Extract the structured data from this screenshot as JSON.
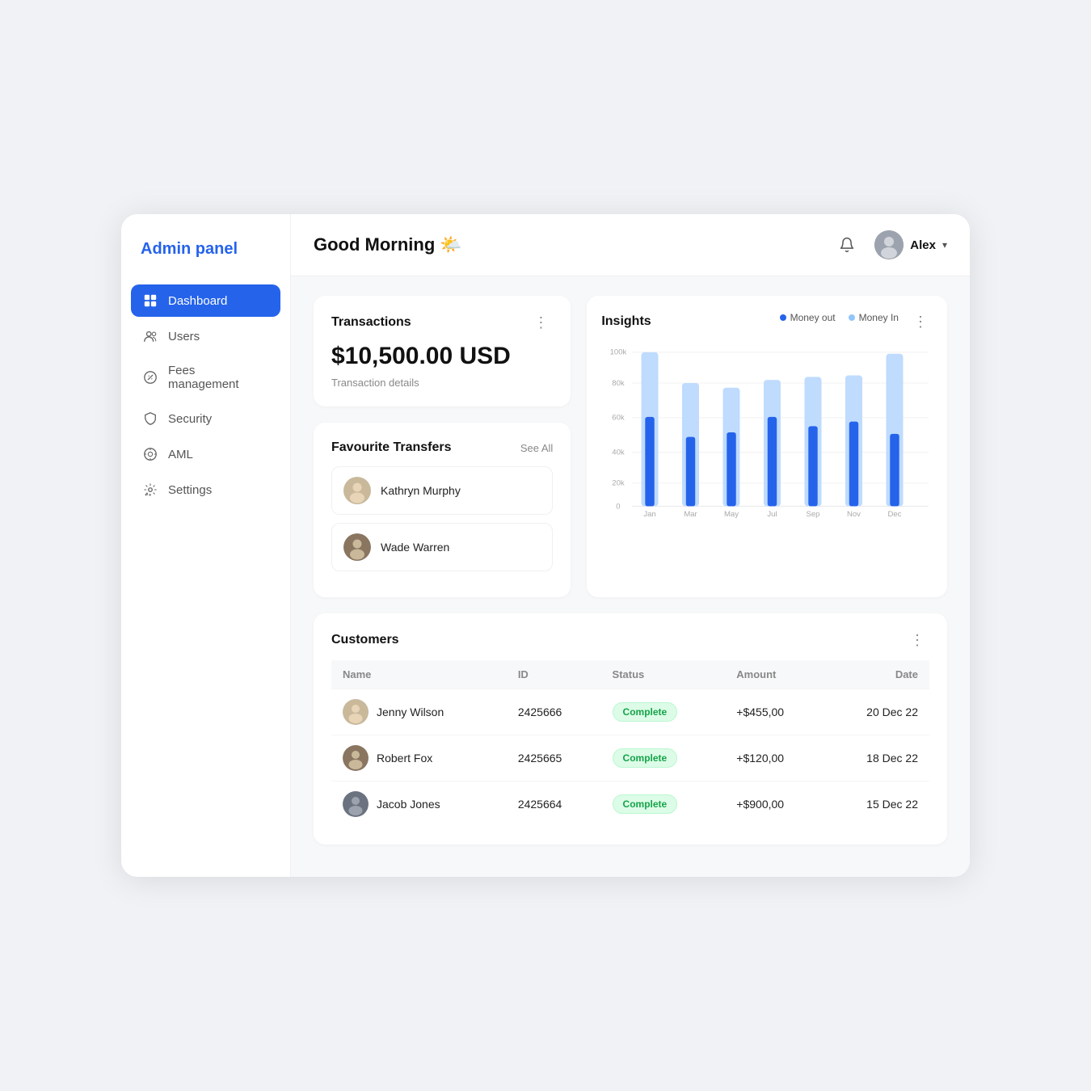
{
  "app": {
    "logo_blue": "Admin",
    "logo_dark": " panel"
  },
  "sidebar": {
    "items": [
      {
        "id": "dashboard",
        "label": "Dashboard",
        "active": true
      },
      {
        "id": "users",
        "label": "Users",
        "active": false
      },
      {
        "id": "fees",
        "label": "Fees management",
        "active": false
      },
      {
        "id": "security",
        "label": "Security",
        "active": false
      },
      {
        "id": "aml",
        "label": "AML",
        "active": false
      },
      {
        "id": "settings",
        "label": "Settings",
        "active": false
      }
    ]
  },
  "header": {
    "greeting": "Good Morning",
    "greeting_emoji": "🌤️",
    "user_name": "Alex",
    "bell_title": "Notifications"
  },
  "transactions": {
    "title": "Transactions",
    "amount": "$10,500.00 USD",
    "details_link": "Transaction details"
  },
  "favourite_transfers": {
    "title": "Favourite Transfers",
    "see_all": "See All",
    "contacts": [
      {
        "name": "Kathryn Murphy"
      },
      {
        "name": "Wade Warren"
      }
    ]
  },
  "insights": {
    "title": "Insights",
    "legend": [
      {
        "label": "Money out",
        "color": "#2563eb"
      },
      {
        "label": "Money In",
        "color": "#93c5fd"
      }
    ],
    "months": [
      "Jan",
      "Mar",
      "May",
      "Jul",
      "Sep",
      "Nov",
      "Dec"
    ],
    "y_labels": [
      "0",
      "20k",
      "40k",
      "60k",
      "80k",
      "100k"
    ],
    "bars": [
      {
        "month": "Jan",
        "out": 58,
        "in": 100
      },
      {
        "month": "Mar",
        "out": 45,
        "in": 82
      },
      {
        "month": "May",
        "out": 48,
        "in": 78
      },
      {
        "month": "Jul",
        "out": 58,
        "in": 84
      },
      {
        "month": "Sep",
        "out": 52,
        "in": 85
      },
      {
        "month": "Nov",
        "out": 55,
        "in": 86
      },
      {
        "month": "Dec",
        "out": 48,
        "in": 99
      }
    ]
  },
  "customers": {
    "title": "Customers",
    "columns": [
      "Name",
      "ID",
      "Status",
      "Amount",
      "Date"
    ],
    "rows": [
      {
        "name": "Jenny Wilson",
        "id": "2425666",
        "status": "Complete",
        "amount": "+$455,00",
        "date": "20 Dec 22"
      },
      {
        "name": "Robert Fox",
        "id": "2425665",
        "status": "Complete",
        "amount": "+$120,00",
        "date": "18 Dec 22"
      },
      {
        "name": "Jacob Jones",
        "id": "2425664",
        "status": "Complete",
        "amount": "+$900,00",
        "date": "15 Dec 22"
      }
    ]
  }
}
